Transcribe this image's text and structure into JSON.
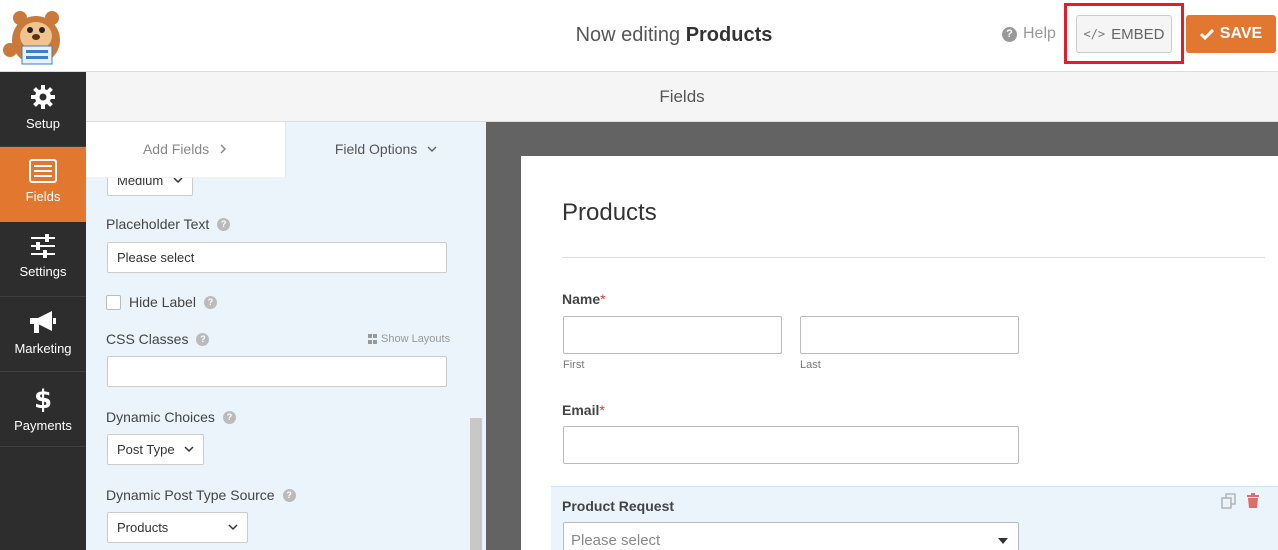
{
  "header": {
    "title_prefix": "Now editing",
    "form_name": "Products",
    "help_label": "Help",
    "embed_label": "EMBED",
    "save_label": "SAVE"
  },
  "nav": [
    {
      "label": "Setup",
      "icon": "gear-icon",
      "active": false
    },
    {
      "label": "Fields",
      "icon": "fields-list-icon",
      "active": true
    },
    {
      "label": "Settings",
      "icon": "sliders-icon",
      "active": false
    },
    {
      "label": "Marketing",
      "icon": "megaphone-icon",
      "active": false
    },
    {
      "label": "Payments",
      "icon": "dollar-icon",
      "active": false
    }
  ],
  "fields_header": "Fields",
  "panel": {
    "tabs": {
      "add": "Add Fields",
      "options": "Field Options"
    },
    "size_value": "Medium",
    "placeholder_label": "Placeholder Text",
    "placeholder_value": "Please select",
    "hide_label": "Hide Label",
    "css_classes_label": "CSS Classes",
    "show_layouts": "Show Layouts",
    "css_classes_value": "",
    "dynamic_choices_label": "Dynamic Choices",
    "dynamic_choices_value": "Post Type",
    "dynamic_source_label": "Dynamic Post Type Source",
    "dynamic_source_value": "Products"
  },
  "preview": {
    "form_title": "Products",
    "name_label": "Name",
    "required_mark": "*",
    "first_label": "First",
    "last_label": "Last",
    "email_label": "Email",
    "product_request_label": "Product Request",
    "product_select_placeholder": "Please select"
  },
  "colors": {
    "accent": "#e27730",
    "nav_bg": "#2d2d2d",
    "highlight": "#e11d2b",
    "panel_bg": "#ebf3fb"
  }
}
